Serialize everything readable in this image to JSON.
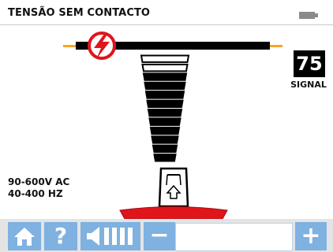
{
  "header": {
    "title": "TENSÃO SEM CONTACTO",
    "battery_icon": "battery-icon"
  },
  "signal": {
    "value": "75",
    "label": "SIGNAL",
    "segments_lit": 10,
    "segments_total": 12
  },
  "specs": {
    "voltage": "90-600V AC",
    "frequency": "40-400 HZ"
  },
  "icons": {
    "voltage": "lightning-bolt-icon",
    "probe": "probe-icon"
  },
  "toolbar": {
    "home": "home-icon",
    "help": "?",
    "volume": "volume-icon",
    "minus": "−",
    "plus": "+"
  },
  "colors": {
    "accent": "#7fb1e1",
    "warning_red": "#e0151c",
    "cable_orange": "#f5a623"
  }
}
